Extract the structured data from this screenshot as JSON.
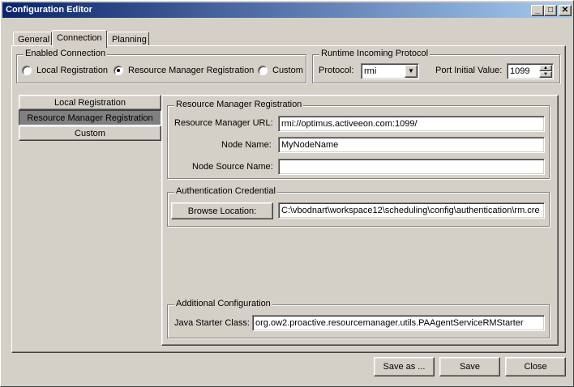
{
  "window": {
    "title": "Configuration Editor",
    "controls": {
      "minimize": "_",
      "maximize": "□",
      "close": "✕"
    }
  },
  "tabs": [
    {
      "label": "General"
    },
    {
      "label": "Connection"
    },
    {
      "label": "Planning"
    }
  ],
  "enabled_connection": {
    "legend": "Enabled Connection",
    "options": [
      {
        "label": "Local Registration",
        "selected": false
      },
      {
        "label": "Resource Manager Registration",
        "selected": true
      },
      {
        "label": "Custom",
        "selected": false
      }
    ]
  },
  "runtime_protocol": {
    "legend": "Runtime Incoming Protocol",
    "protocol_label": "Protocol:",
    "protocol_value": "rmi",
    "port_label": "Port Initial Value:",
    "port_value": "1099"
  },
  "side_nav": [
    {
      "label": "Local Registration",
      "selected": false
    },
    {
      "label": "Resource Manager Registration",
      "selected": true
    },
    {
      "label": "Custom",
      "selected": false
    }
  ],
  "rm_registration": {
    "legend": "Resource Manager Registration",
    "url_label": "Resource Manager URL:",
    "url_value": "rmi://optimus.activeeon.com:1099/",
    "node_name_label": "Node Name:",
    "node_name_value": "MyNodeName",
    "node_source_label": "Node Source Name:",
    "node_source_value": ""
  },
  "auth": {
    "legend": "Authentication Credential",
    "browse_label": "Browse Location:",
    "path_value": "C:\\vbodnart\\workspace12\\scheduling\\config\\authentication\\rm.cre"
  },
  "additional": {
    "legend": "Additional Configuration",
    "java_label": "Java Starter Class:",
    "java_value": "org.ow2.proactive.resourcemanager.utils.PAAgentServiceRMStarter"
  },
  "footer": {
    "save_as": "Save as ...",
    "save": "Save",
    "close": "Close"
  },
  "colors": {
    "title_gradient_start": "#0a246a",
    "title_gradient_end": "#a6caf0",
    "face": "#d4d0c8",
    "selected_nav": "#808080"
  }
}
